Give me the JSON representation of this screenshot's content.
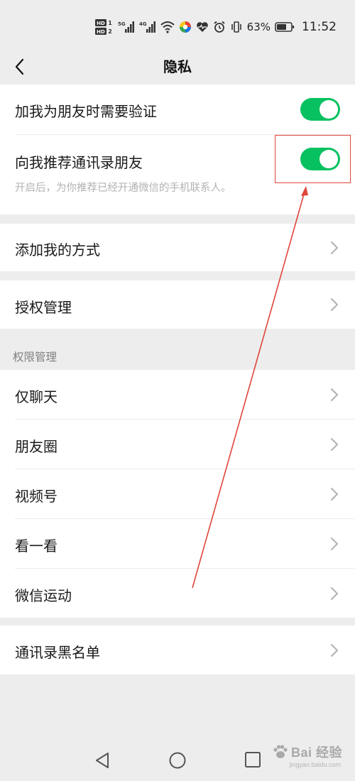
{
  "status_bar": {
    "sim1": "HD 1",
    "sim2": "HD 2",
    "net1": "5G",
    "net2": "4G",
    "battery": "63%",
    "time": "11:52"
  },
  "nav": {
    "title": "隐私"
  },
  "section1": {
    "verify_label": "加我为朋友时需要验证",
    "verify_on": true,
    "recommend_label": "向我推荐通讯录朋友",
    "recommend_desc": "开启后，为你推荐已经开通微信的手机联系人。",
    "recommend_on": true
  },
  "section2": {
    "add_methods_label": "添加我的方式"
  },
  "section3": {
    "auth_label": "授权管理"
  },
  "permissions": {
    "header": "权限管理",
    "items": [
      {
        "label": "仅聊天"
      },
      {
        "label": "朋友圈"
      },
      {
        "label": "视频号"
      },
      {
        "label": "看一看"
      },
      {
        "label": "微信运动"
      }
    ]
  },
  "section5": {
    "blacklist_label": "通讯录黑名单"
  },
  "colors": {
    "toggle_on": "#07c160",
    "background": "#ededed",
    "annotation": "#e0453a"
  },
  "watermark": {
    "main": "Bai 经验",
    "sub": "jingyan.baidu.com"
  }
}
